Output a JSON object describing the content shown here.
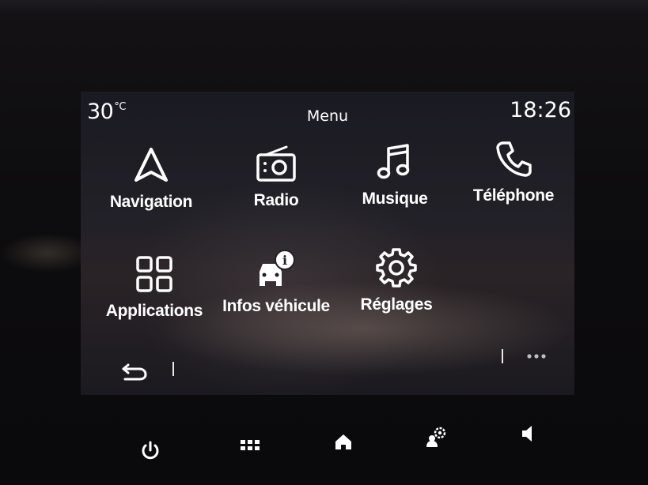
{
  "status": {
    "temperature": "30",
    "temperature_unit": "°C",
    "title": "Menu",
    "time": "18:26"
  },
  "menu": {
    "items": [
      {
        "label": "Navigation",
        "icon": "navigation-arrow-icon"
      },
      {
        "label": "Radio",
        "icon": "radio-icon"
      },
      {
        "label": "Musique",
        "icon": "music-note-icon"
      },
      {
        "label": "Téléphone",
        "icon": "phone-icon"
      },
      {
        "label": "Applications",
        "icon": "apps-grid-icon"
      },
      {
        "label": "Infos véhicule",
        "icon": "vehicle-info-icon"
      },
      {
        "label": "Réglages",
        "icon": "gear-icon"
      }
    ]
  },
  "bottom_bar": {
    "back_icon": "back-arrow-icon",
    "more_icon": "more-dots-icon"
  },
  "hardware_buttons": [
    {
      "icon": "power-icon"
    },
    {
      "icon": "menu-grid-icon"
    },
    {
      "icon": "home-icon"
    },
    {
      "icon": "settings-profile-icon"
    },
    {
      "icon": "volume-icon"
    }
  ],
  "colors": {
    "foreground": "#ffffff",
    "screen_background": "#1d1c22",
    "bezel": "#0d0c0e"
  }
}
